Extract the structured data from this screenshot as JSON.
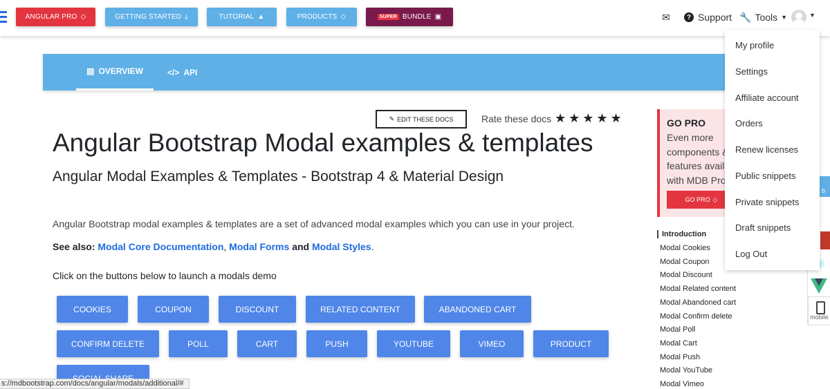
{
  "navbar": {
    "buttons": [
      {
        "label": "ANGULAR PRO",
        "icon": "gem-icon"
      },
      {
        "label": "GETTING STARTED",
        "icon": "download-icon"
      },
      {
        "label": "TUTORIAL",
        "icon": "graduation-cap-icon"
      },
      {
        "label": "PRODUCTS",
        "icon": "gem-icon"
      },
      {
        "label": "BUNDLE",
        "tag": "SUPER",
        "icon": "gift-icon"
      }
    ],
    "support_label": "Support",
    "tools_label": "Tools"
  },
  "user_menu": {
    "items": [
      "My profile",
      "Settings",
      "Affiliate account",
      "Orders",
      "Renew licenses",
      "Public snippets",
      "Private snippets",
      "Draft snippets",
      "Log Out"
    ]
  },
  "docs_tabs": {
    "overview": "OVERVIEW",
    "api": "API"
  },
  "content": {
    "edit_docs": "EDIT THESE DOCS",
    "rate_label": "Rate these docs",
    "stars": "★★★★★",
    "title": "Angular Bootstrap Modal examples & templates",
    "subtitle": "Angular Modal Examples & Templates - Bootstrap 4 & Material Design",
    "intro": "Angular Bootstrap modal examples & templates are a set of advanced modal examples which you can use in your project.",
    "see_also_label": "See also:",
    "see_also_links": [
      "Modal Core Documentation",
      "Modal Forms",
      "Modal Styles"
    ],
    "see_also_and": "and",
    "click_text": "Click on the buttons below to launch a modals demo",
    "demo_buttons": [
      "COOKIES",
      "COUPON",
      "DISCOUNT",
      "RELATED CONTENT",
      "ABANDONED CART",
      "CONFIRM DELETE",
      "POLL",
      "CART",
      "PUSH",
      "YOUTUBE",
      "VIMEO",
      "PRODUCT",
      "SOCIAL SHARE"
    ]
  },
  "go_pro": {
    "title": "GO PRO",
    "lines": [
      "Even more",
      "components &",
      "features availa",
      "with MDB Pro."
    ],
    "button": "GO PRO"
  },
  "toc": {
    "items": [
      "Introduction",
      "Modal Cookies",
      "Modal Coupon",
      "Modal Discount",
      "Modal Related content",
      "Modal Abandoned cart",
      "Modal Confirm delete",
      "Modal Poll",
      "Modal Cart",
      "Modal Push",
      "Modal YouTube",
      "Modal Vimeo"
    ]
  },
  "side_widget": {
    "blue_text": "b",
    "mobile_label": "mobile"
  },
  "status_url": "s://mdbootstrap.com/docs/angular/modals/additional/#",
  "colors": {
    "primary": "#4f86e8",
    "info": "#5fb0e6",
    "danger": "#e3353f",
    "bundle": "#7a1a4c"
  }
}
